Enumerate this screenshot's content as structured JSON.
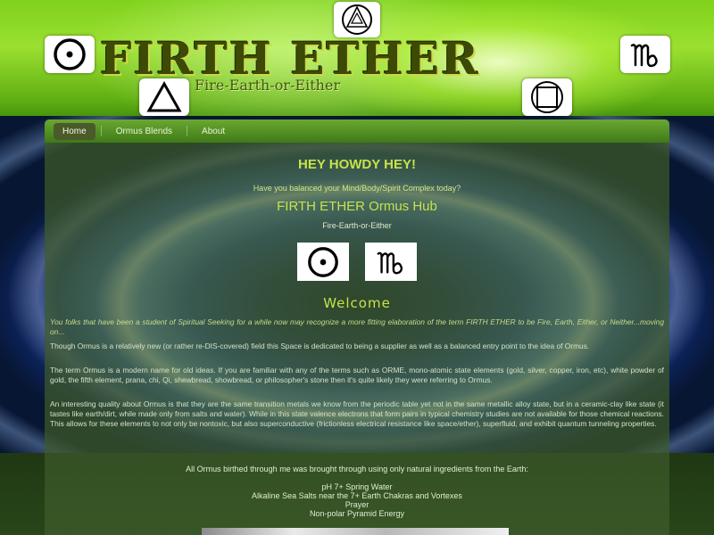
{
  "header": {
    "title": "FIRTH ETHER",
    "tagline": "Fire-Earth-or-Either",
    "icons": [
      "sun-circle-icon",
      "triangle-icon",
      "pentagram-circle-icon",
      "circle-square-icon",
      "virgo-icon"
    ]
  },
  "nav": {
    "items": [
      {
        "label": "Home",
        "active": true
      },
      {
        "label": "Ormus Blends",
        "active": false
      },
      {
        "label": "About",
        "active": false
      }
    ]
  },
  "main": {
    "headline": "HEY HOWDY HEY!",
    "question": "Have you balanced your Mind/Body/Spirit Complex today?",
    "hub_title": "FIRTH ETHER Ormus Hub",
    "hub_subtitle": "Fire-Earth-or-Either",
    "symbols": [
      "sun-circle-icon",
      "virgo-icon"
    ],
    "welcome": "Welcome",
    "paragraphs": [
      "You folks that have been a student of Spiritual Seeking for a while now may recognize a more fitting elaboration of the term FIRTH ETHER to be Fire, Earth, Either, or Neither...moving on...",
      "Though Ormus is a relatively new (or rather re-DIS-covered) field this Space is dedicated to being a supplier as well as a balanced entry point to the idea of Ormus.",
      "The term Ormus is a modern name for old ideas. If you are familiar with any of the terms such as ORME, mono-atomic state elements (gold, silver, copper, iron, etc), white powder of gold, the fifth element, prana, chi, Qi, shewbread, showbread, or philosopher's stone then it's quite likely they were referring to Ormus.",
      "An interesting quality about Ormus is that they are the same transition metals we know from the periodic table yet not in the same metallic alloy state, but in a ceramic-clay like state (it tastes like earth/dirt, while made only from salts and water). While in this state valence electrons that form pairs in typical chemistry studies are not available for those chemical reactions. This allows for these elements to not only be nontoxic, but also superconductive (frictionless electrical resistance like space/ether), superfluid, and exhibit quantum tunneling properties."
    ]
  },
  "bottom": {
    "intro": "All Ormus birthed through me was brought through using only natural ingredients from the Earth:",
    "ingredients": [
      "pH 7+ Spring Water",
      "Alkaline Sea Salts near the 7+ Earth Chakras and Vortexes",
      "Prayer",
      "Non-polar Pyramid Energy"
    ]
  },
  "colors": {
    "accent": "#c8e24a",
    "nav_bg": "#4f8a22",
    "content_bg": "#3e5a28"
  }
}
